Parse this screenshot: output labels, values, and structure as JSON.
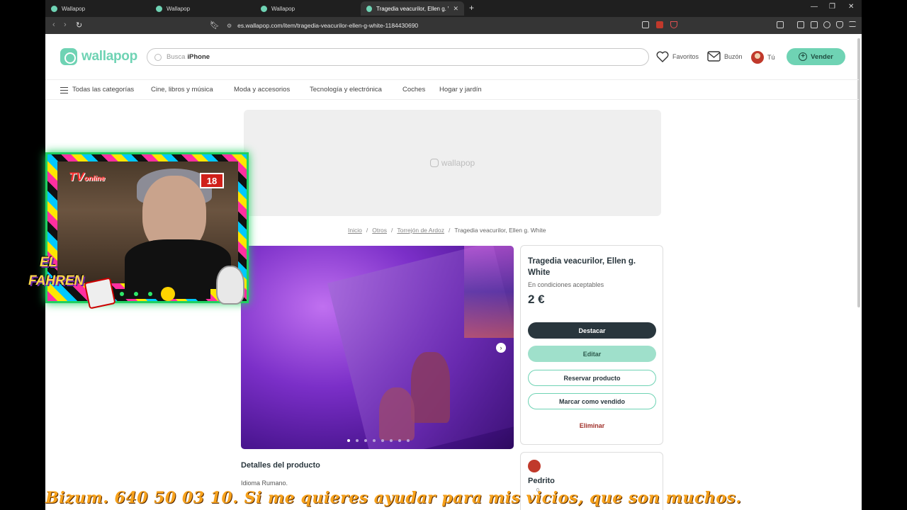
{
  "browser": {
    "tabs": [
      {
        "label": "Wallapop",
        "active": false
      },
      {
        "label": "Wallapop",
        "active": false
      },
      {
        "label": "Wallapop",
        "active": false
      },
      {
        "label": "Tragedia veacurilor, Ellen g. Whi",
        "active": true
      }
    ],
    "url": "es.wallapop.com/item/tragedia-veacurilor-ellen-g-white-1184430690"
  },
  "header": {
    "logo_text": "wallapop",
    "search_prefix": "Busca",
    "search_term": "iPhone",
    "favoritos": "Favoritos",
    "buzon": "Buzón",
    "tu": "Tú",
    "vender": "Vender"
  },
  "categories": [
    "Todas las categorías",
    "Cine, libros y música",
    "Moda y accesorios",
    "Tecnología y electrónica",
    "Coches",
    "Hogar y jardín"
  ],
  "ad_logo": "wallapop",
  "breadcrumb": {
    "items": [
      "Inicio",
      "Otros",
      "Torrejón de Ardoz"
    ],
    "current": "Tragedia veacurilor, Ellen g. White"
  },
  "product": {
    "title": "Tragedia veacurilor, Ellen g. White",
    "condition": "En condiciones aceptables",
    "price": "2 €",
    "destacar": "Destacar",
    "editar": "Editar",
    "reservar": "Reservar producto",
    "vendido": "Marcar como vendido",
    "eliminar": "Eliminar"
  },
  "details": {
    "heading": "Detalles del producto",
    "text": "Idioma Rumano."
  },
  "seller": {
    "name": "Pedrito",
    "reviews": "0"
  },
  "overlay": {
    "tv_label": "TV",
    "tv_sub": "online",
    "age": "18",
    "show_name_line1": "EL",
    "show_name_line2": "FAHREN",
    "ticker": "Bizum. 640 50 03 10.  Si me quieres ayudar para mis vicios, que son muchos."
  },
  "colors": {
    "brand": "#6fd3b4",
    "dark": "#29363d",
    "danger": "#a0302a",
    "ticker": "#f7a21c"
  }
}
